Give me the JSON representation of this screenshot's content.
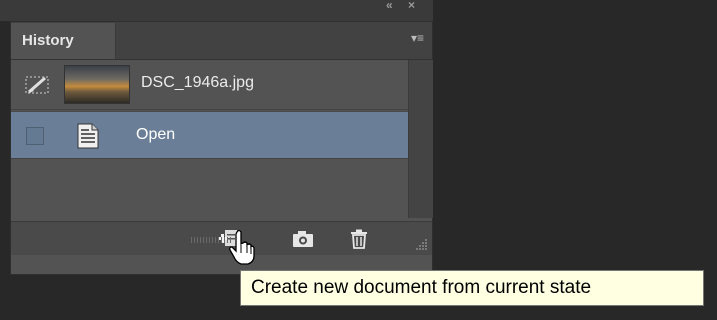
{
  "panel": {
    "tab_label": "History",
    "menu_icon": "panel-menu-icon",
    "collapse_icon": "collapse-icon",
    "close_icon": "close-icon"
  },
  "snapshot": {
    "name": "DSC_1946a.jpg",
    "icon": "history-brush-icon"
  },
  "states": [
    {
      "label": "Open",
      "icon": "document-icon",
      "selected": true
    }
  ],
  "bottom_bar": {
    "buttons": [
      {
        "name": "create-new-document-button",
        "icon": "new-document-icon"
      },
      {
        "name": "create-snapshot-button",
        "icon": "camera-icon"
      },
      {
        "name": "delete-state-button",
        "icon": "trash-icon"
      }
    ]
  },
  "tooltip": {
    "text": "Create new document from current state"
  },
  "colors": {
    "background": "#282828",
    "panel": "#535353",
    "selected_row": "#6a7f97",
    "tooltip_bg": "#ffffe1"
  }
}
